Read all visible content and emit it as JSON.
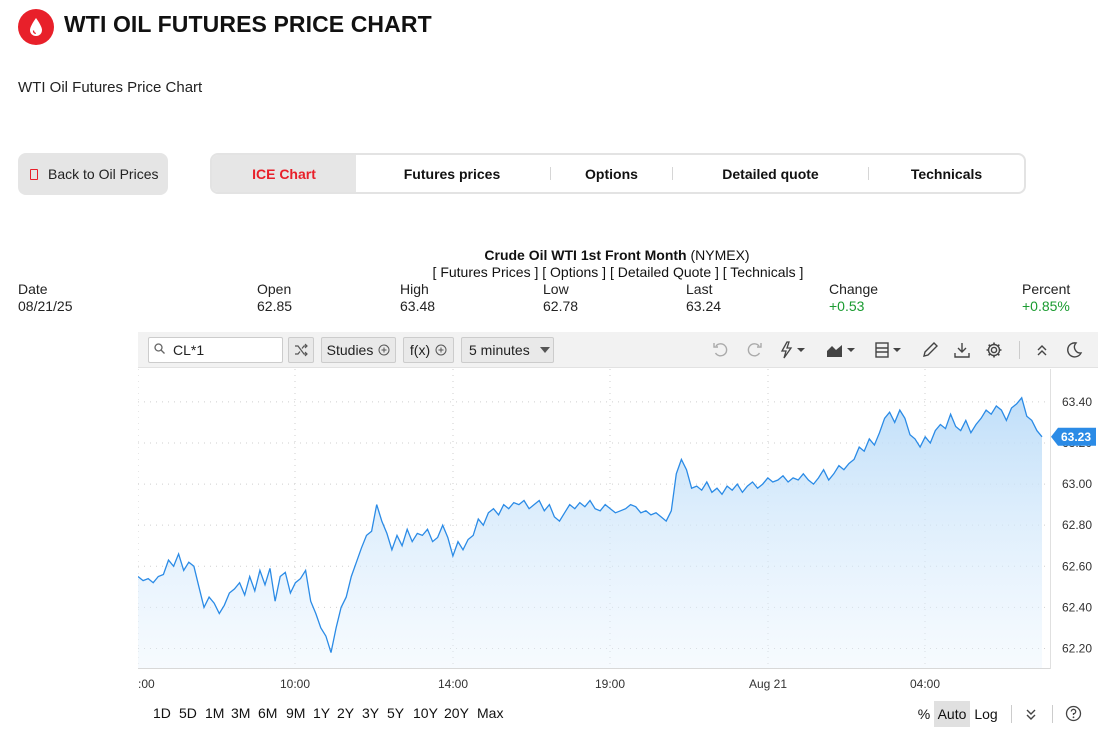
{
  "header": {
    "title": "WTI OIL FUTURES PRICE CHART",
    "subtitle": "WTI Oil Futures Price Chart",
    "logo_color": "#e8202a"
  },
  "back_button": {
    "label": "Back to Oil Prices"
  },
  "tabs": [
    {
      "label": "ICE Chart",
      "active": true
    },
    {
      "label": "Futures prices",
      "active": false
    },
    {
      "label": "Options",
      "active": false
    },
    {
      "label": "Detailed quote",
      "active": false
    },
    {
      "label": "Technicals",
      "active": false
    }
  ],
  "chart_header": {
    "name": "Crude Oil WTI 1st Front Month",
    "exchange": "(NYMEX)",
    "links": "[ Futures Prices ] [ Options ] [ Detailed Quote ] [ Technicals ]"
  },
  "quote": {
    "date_label": "Date",
    "date": "08/21/25",
    "open_label": "Open",
    "open": "62.85",
    "high_label": "High",
    "high": "63.48",
    "low_label": "Low",
    "low": "62.78",
    "last_label": "Last",
    "last": "63.24",
    "change_label": "Change",
    "change": "+0.53",
    "percent_label": "Percent",
    "percent": "+0.85%",
    "positive_color": "#1a9b30"
  },
  "toolbar": {
    "symbol_value": "CL*1",
    "studies_label": "Studies",
    "fx_label": "f(x)",
    "interval_label": "5 minutes",
    "icons": [
      "undo-icon",
      "redo-icon",
      "lightning-icon",
      "area-chart-icon",
      "layout-icon",
      "pencil-icon",
      "download-icon",
      "gear-icon",
      "collapse-icon",
      "moon-icon"
    ]
  },
  "ranges": [
    "1D",
    "5D",
    "1M",
    "3M",
    "6M",
    "9M",
    "1Y",
    "2Y",
    "3Y",
    "5Y",
    "10Y",
    "20Y",
    "Max"
  ],
  "scale": {
    "percent": "%",
    "auto": "Auto",
    "log": "Log",
    "active": "Auto"
  },
  "chart_data": {
    "type": "area",
    "series_color": "#2b8be6",
    "x_ticks": [
      ":00",
      "10:00",
      "14:00",
      "19:00",
      "Aug 21",
      "04:00"
    ],
    "y_ticks": [
      "62.20",
      "62.40",
      "62.60",
      "62.80",
      "63.00",
      "63.20",
      "63.40"
    ],
    "ylim": [
      62.1,
      63.56
    ],
    "last_label": "63.23",
    "grid": true,
    "values": [
      62.55,
      62.53,
      62.54,
      62.52,
      62.55,
      62.56,
      62.63,
      62.6,
      62.66,
      62.58,
      62.62,
      62.6,
      62.5,
      62.4,
      62.45,
      62.42,
      62.37,
      62.41,
      62.47,
      62.49,
      62.52,
      62.46,
      62.55,
      62.48,
      62.58,
      62.51,
      62.59,
      62.43,
      62.55,
      62.57,
      62.47,
      62.52,
      62.54,
      62.58,
      62.43,
      62.37,
      62.3,
      62.26,
      62.18,
      62.3,
      62.4,
      62.45,
      62.55,
      62.62,
      62.69,
      62.75,
      62.77,
      62.9,
      62.82,
      62.76,
      62.68,
      62.75,
      62.7,
      62.78,
      62.72,
      62.76,
      62.75,
      62.78,
      62.72,
      62.74,
      62.8,
      62.74,
      62.65,
      62.72,
      62.68,
      62.73,
      62.75,
      62.83,
      62.8,
      62.86,
      62.88,
      62.85,
      62.9,
      62.88,
      62.91,
      62.9,
      62.92,
      62.88,
      62.9,
      62.92,
      62.87,
      62.9,
      62.84,
      62.82,
      62.86,
      62.9,
      62.88,
      62.91,
      62.89,
      62.92,
      62.88,
      62.87,
      62.9,
      62.88,
      62.86,
      62.87,
      62.88,
      62.9,
      62.89,
      62.86,
      62.87,
      62.85,
      62.86,
      62.84,
      62.82,
      62.87,
      63.05,
      63.12,
      63.07,
      62.98,
      62.99,
      62.97,
      63.01,
      62.96,
      62.98,
      62.95,
      62.99,
      62.97,
      63.0,
      62.96,
      62.99,
      63.01,
      62.98,
      63.0,
      63.03,
      63.01,
      63.02,
      63.04,
      63.01,
      63.03,
      63.02,
      63.05,
      63.02,
      63.0,
      63.03,
      63.07,
      63.02,
      63.05,
      63.09,
      63.07,
      63.1,
      63.12,
      63.18,
      63.16,
      63.22,
      63.19,
      63.25,
      63.32,
      63.35,
      63.3,
      63.36,
      63.32,
      63.24,
      63.22,
      63.18,
      63.23,
      63.2,
      63.26,
      63.29,
      63.27,
      63.34,
      63.28,
      63.26,
      63.31,
      63.25,
      63.29,
      63.32,
      63.36,
      63.34,
      63.38,
      63.36,
      63.31,
      63.37,
      63.39,
      63.42,
      63.33,
      63.31,
      63.26,
      63.23
    ]
  }
}
